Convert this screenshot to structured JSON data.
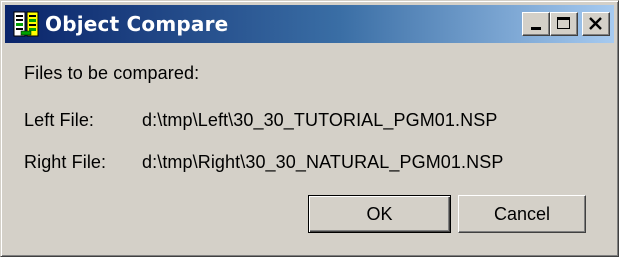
{
  "window": {
    "title": "Object Compare",
    "icon": "object-compare-app-icon",
    "controls": {
      "minimize": "minimize-icon",
      "maximize": "maximize-icon",
      "close": "close-icon"
    }
  },
  "dialog": {
    "heading": "Files to be compared:",
    "left_file": {
      "label": "Left File:",
      "value": "d:\\tmp\\Left\\30_30_TUTORIAL_PGM01.NSP"
    },
    "right_file": {
      "label": "Right File:",
      "value": "d:\\tmp\\Right\\30_30_NATURAL_PGM01.NSP"
    }
  },
  "buttons": {
    "ok_label": "OK",
    "cancel_label": "Cancel"
  },
  "colors": {
    "titlebar_start": "#0a246a",
    "titlebar_end": "#a6caf0",
    "dialog_face": "#d4d0c8"
  }
}
